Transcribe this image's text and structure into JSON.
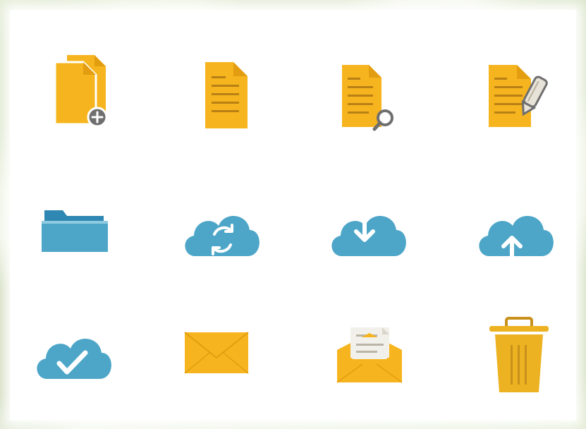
{
  "colors": {
    "document": "#F6B51E",
    "document_fold": "#E39D10",
    "line": "#B98016",
    "cloud": "#4DA6C8",
    "cloud_white": "#FFFFFF",
    "badge": "#6F6F6F",
    "trash": "#EDB221"
  },
  "icons": [
    {
      "name": "copy-document-add-icon"
    },
    {
      "name": "document-icon"
    },
    {
      "name": "document-search-icon"
    },
    {
      "name": "document-edit-icon"
    },
    {
      "name": "folder-icon"
    },
    {
      "name": "cloud-sync-icon"
    },
    {
      "name": "cloud-download-icon"
    },
    {
      "name": "cloud-upload-icon"
    },
    {
      "name": "cloud-check-icon"
    },
    {
      "name": "envelope-icon"
    },
    {
      "name": "open-envelope-icon"
    },
    {
      "name": "trash-bin-icon"
    }
  ]
}
